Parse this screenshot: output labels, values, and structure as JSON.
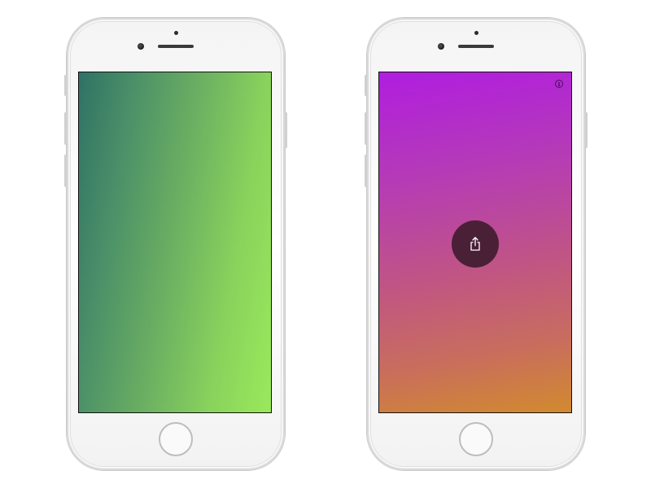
{
  "devices": [
    {
      "name": "left-phone",
      "screen": {
        "type": "gradient-wallpaper",
        "gradient_colors": [
          "#2f7265",
          "#4a8f68",
          "#6aae62",
          "#89d25c",
          "#9ae95b"
        ]
      }
    },
    {
      "name": "right-phone",
      "screen": {
        "type": "gradient-wallpaper",
        "gradient_colors": [
          "#b01de0",
          "#b53bb6",
          "#c05584",
          "#c86d5e",
          "#d28a2e"
        ],
        "info_button": {
          "icon": "info-icon",
          "glyph": "i"
        },
        "share_button": {
          "icon": "share-icon",
          "color": "#4a2037"
        }
      }
    }
  ],
  "colors": {
    "phone_body": "#f5f5f5",
    "phone_border": "#d0d0d0",
    "background": "#ffffff"
  }
}
